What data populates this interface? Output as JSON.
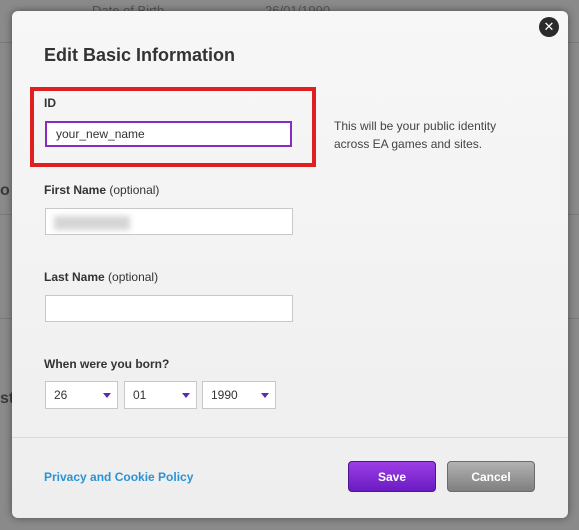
{
  "background": {
    "top_left_text": "Date of Birth",
    "top_right_text": "26/01/1990",
    "side_letter_1": "o",
    "side_letter_2": "st"
  },
  "modal": {
    "title": "Edit Basic Information",
    "close_icon": "close-icon",
    "id_field": {
      "label": "ID",
      "value": "your_new_name",
      "hint": "This will be your public identity across EA games and sites."
    },
    "first_name": {
      "label": "First Name",
      "optional": "(optional)",
      "value": ""
    },
    "last_name": {
      "label": "Last Name",
      "optional": "(optional)",
      "value": ""
    },
    "birth": {
      "label": "When were you born?",
      "day": "26",
      "month": "01",
      "year": "1990"
    },
    "policy_link": "Privacy and Cookie Policy",
    "save_label": "Save",
    "cancel_label": "Cancel",
    "colors": {
      "accent": "#6a1bc2",
      "link": "#2a93d5",
      "highlight": "#e02020"
    }
  }
}
